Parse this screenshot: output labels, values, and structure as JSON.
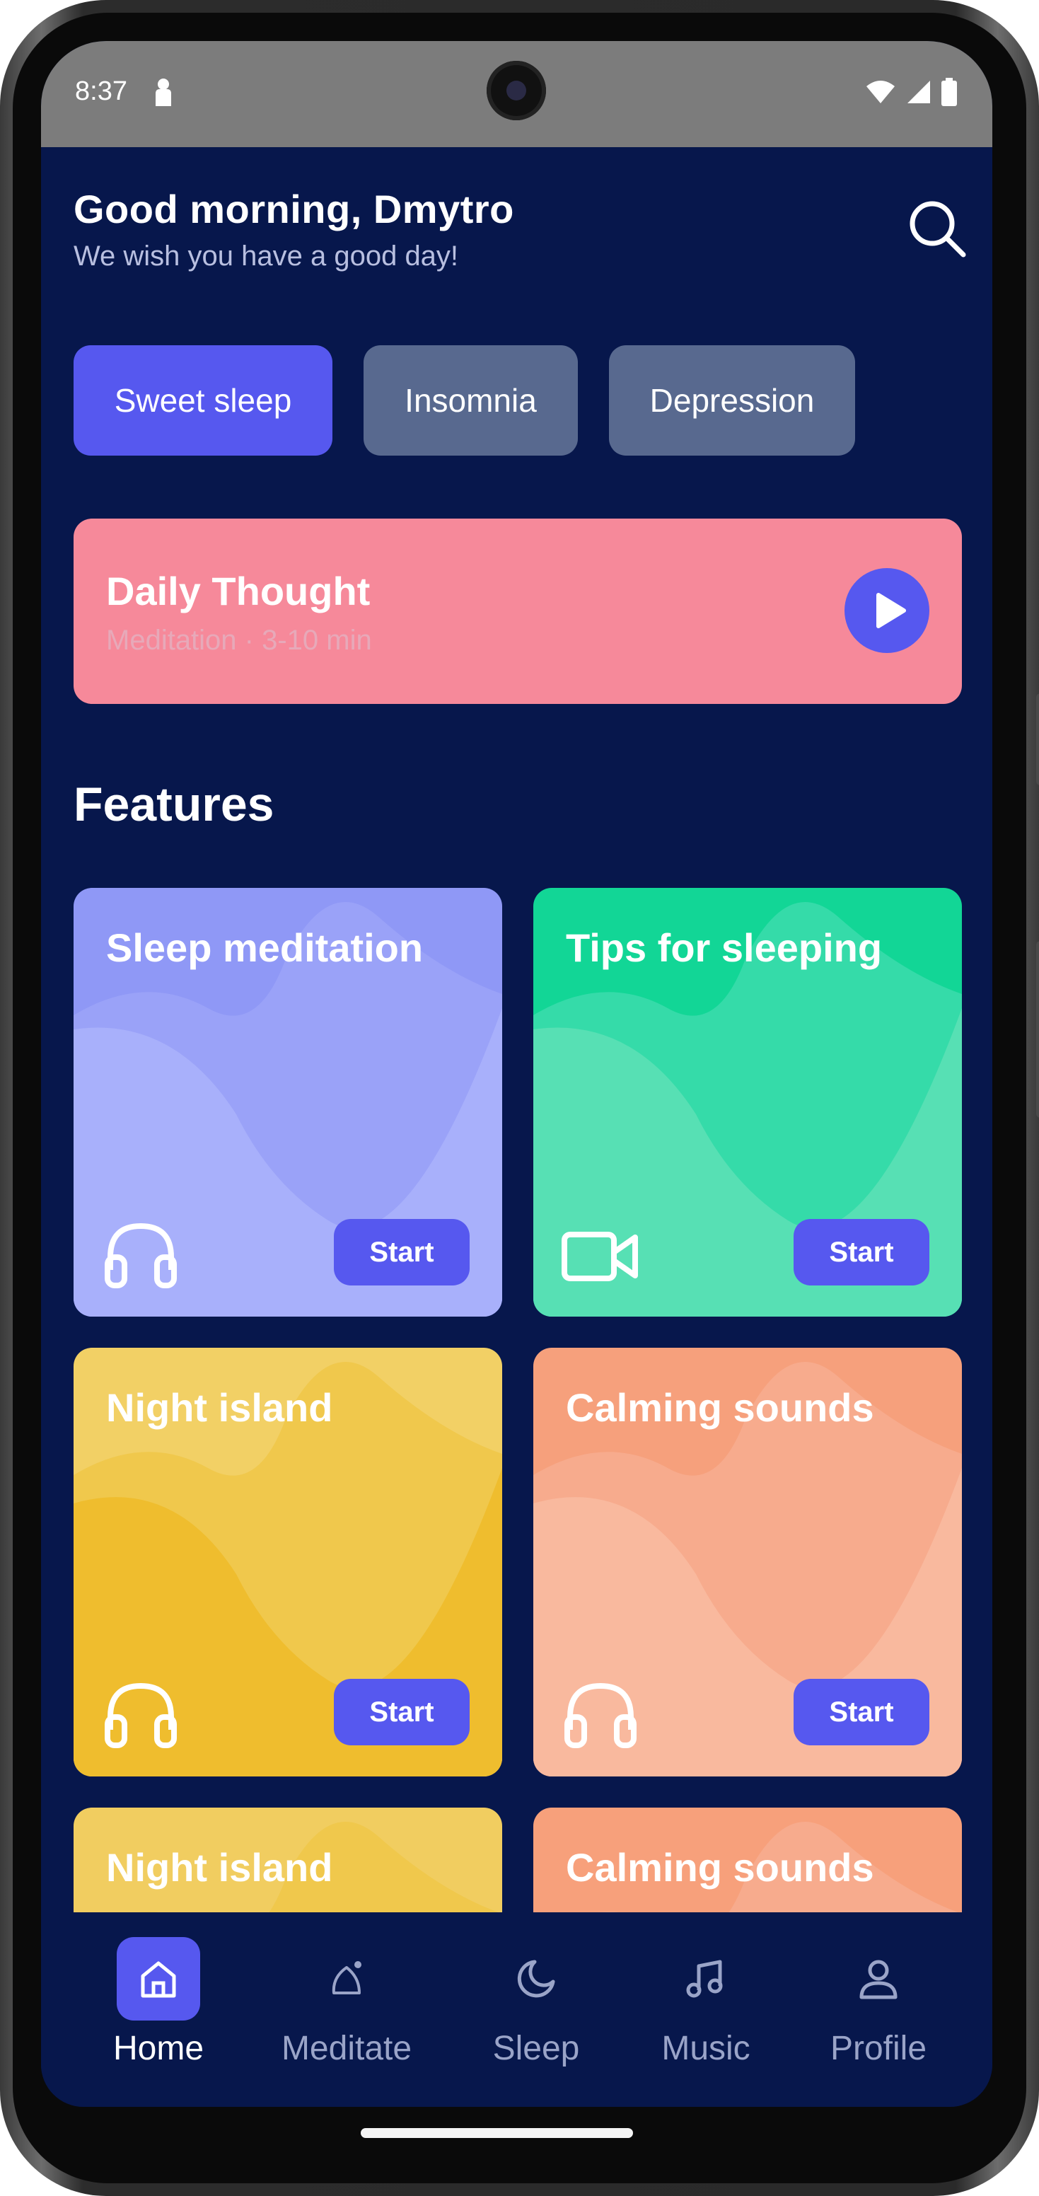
{
  "status_bar": {
    "time": "8:37"
  },
  "header": {
    "greeting": "Good morning, Dmytro",
    "subtitle": "We wish you have a good day!"
  },
  "chips": [
    {
      "label": "Sweet sleep",
      "active": true
    },
    {
      "label": "Insomnia",
      "active": false
    },
    {
      "label": "Depression",
      "active": false
    }
  ],
  "daily_thought": {
    "title": "Daily Thought",
    "subtitle": "Meditation · 3-10 min"
  },
  "features": {
    "title": "Features",
    "cards": [
      {
        "title": "Sleep meditation",
        "icon": "headphones-icon",
        "button": "Start",
        "color": "#a8b0fb"
      },
      {
        "title": "Tips for sleeping",
        "icon": "video-camera-icon",
        "button": "Start",
        "color": "#57e0b4"
      },
      {
        "title": "Night island",
        "icon": "headphones-icon",
        "button": "Start",
        "color": "#efbd2e"
      },
      {
        "title": "Calming sounds",
        "icon": "headphones-icon",
        "button": "Start",
        "color": "#f9b99e"
      },
      {
        "title": "Night island",
        "color": "#f1cd60"
      },
      {
        "title": "Calming sounds",
        "color": "#f7a07b"
      }
    ]
  },
  "nav": [
    {
      "label": "Home",
      "icon": "home-icon",
      "active": true
    },
    {
      "label": "Meditate",
      "icon": "meditate-icon",
      "active": false
    },
    {
      "label": "Sleep",
      "icon": "moon-icon",
      "active": false
    },
    {
      "label": "Music",
      "icon": "music-note-icon",
      "active": false
    },
    {
      "label": "Profile",
      "icon": "profile-icon",
      "active": false
    }
  ],
  "colors": {
    "background": "#07174c",
    "accent": "#5658ef",
    "chip_inactive": "#58698f",
    "daily_card": "#f6899a"
  }
}
